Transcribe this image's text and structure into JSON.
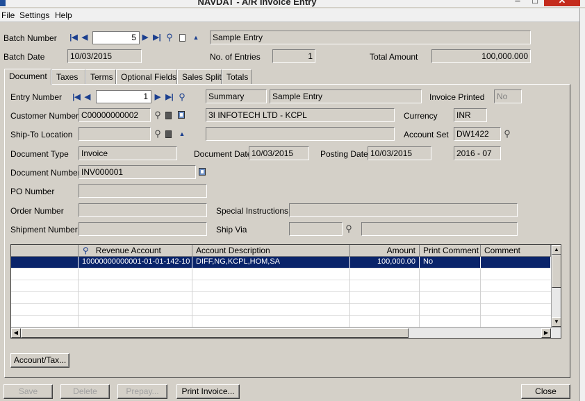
{
  "window": {
    "title": "NAVDAT - A/R Invoice Entry",
    "controls": {
      "minimize": "–",
      "maximize": "□",
      "close": "✕"
    }
  },
  "menu": {
    "file": "File",
    "settings": "Settings",
    "help": "Help"
  },
  "batch": {
    "number_label": "Batch Number",
    "number": "5",
    "description": "Sample Entry",
    "date_label": "Batch Date",
    "date": "10/03/2015",
    "entries_label": "No. of Entries",
    "entries": "1",
    "total_label": "Total Amount",
    "total": "100,000.000"
  },
  "tabs": [
    "Document",
    "Taxes",
    "Terms",
    "Optional Fields",
    "Sales Split",
    "Totals"
  ],
  "active_tab": "Document",
  "document": {
    "entry_number_label": "Entry Number",
    "entry_number": "1",
    "entry_type": "Summary",
    "entry_description": "Sample Entry",
    "invoice_printed_label": "Invoice Printed",
    "invoice_printed": "No",
    "customer_number_label": "Customer Number",
    "customer_number": "C00000000002",
    "customer_name": "3I INFOTECH LTD - KCPL",
    "currency_label": "Currency",
    "currency": "INR",
    "ship_to_label": "Ship-To Location",
    "ship_to": "",
    "ship_to_description": "",
    "account_set_label": "Account Set",
    "account_set": "DW1422",
    "document_type_label": "Document Type",
    "document_type": "Invoice",
    "document_date_label": "Document Date",
    "document_date": "10/03/2015",
    "posting_date_label": "Posting Date",
    "posting_date": "10/03/2015",
    "fiscal_period": "2016 - 07",
    "document_number_label": "Document Number",
    "document_number": "INV000001",
    "po_number_label": "PO Number",
    "po_number": "",
    "order_number_label": "Order Number",
    "order_number": "",
    "special_instructions_label": "Special Instructions",
    "special_instructions": "",
    "shipment_number_label": "Shipment Number",
    "shipment_number": "",
    "ship_via_label": "Ship Via",
    "ship_via": "",
    "ship_via_description": ""
  },
  "grid": {
    "columns": [
      "",
      "Revenue Account",
      "Account Description",
      "Amount",
      "Print Comment",
      "Comment"
    ],
    "rows": [
      [
        "",
        "10000000000001-01-01-142-10",
        "DIFF,NG,KCPL,HOM,SA",
        "100,000.00",
        "No",
        ""
      ]
    ]
  },
  "buttons": {
    "account_tax": "Account/Tax...",
    "save": "Save",
    "delete": "Delete",
    "prepay": "Prepay...",
    "print_invoice": "Print Invoice...",
    "close": "Close"
  },
  "icons": {
    "first": "first-record-icon",
    "previous": "previous-record-icon",
    "next": "next-record-icon",
    "last": "last-record-icon",
    "finder": "finder-icon",
    "new": "new-document-icon",
    "zoom": "zoom-icon",
    "up": "up-arrow-icon"
  },
  "colors": {
    "selected_row": "#0a246a",
    "window_bg": "#d4d0c8",
    "close_button": "#c42b1c"
  }
}
